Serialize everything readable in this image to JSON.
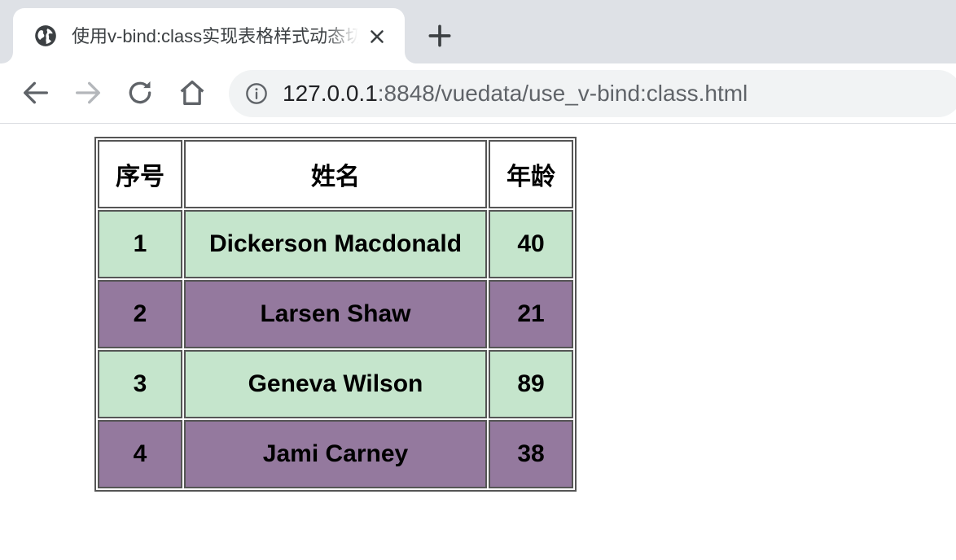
{
  "browser": {
    "tab_title": "使用v-bind:class实现表格样式动态切换",
    "url_host": "127.0.0.1",
    "url_rest": ":8848/vuedata/use_v-bind:class.html"
  },
  "table": {
    "headers": [
      "序号",
      "姓名",
      "年龄"
    ],
    "rows": [
      {
        "id": "1",
        "name": "Dickerson Macdonald",
        "age": "40"
      },
      {
        "id": "2",
        "name": "Larsen Shaw",
        "age": "21"
      },
      {
        "id": "3",
        "name": "Geneva Wilson",
        "age": "89"
      },
      {
        "id": "4",
        "name": "Jami Carney",
        "age": "38"
      }
    ],
    "odd_row_color": "#c5e5cc",
    "even_row_color": "#94799e"
  },
  "icons": [
    "globe-icon",
    "close-icon",
    "plus-icon",
    "back-arrow-icon",
    "forward-arrow-icon",
    "reload-icon",
    "home-icon",
    "info-icon"
  ]
}
